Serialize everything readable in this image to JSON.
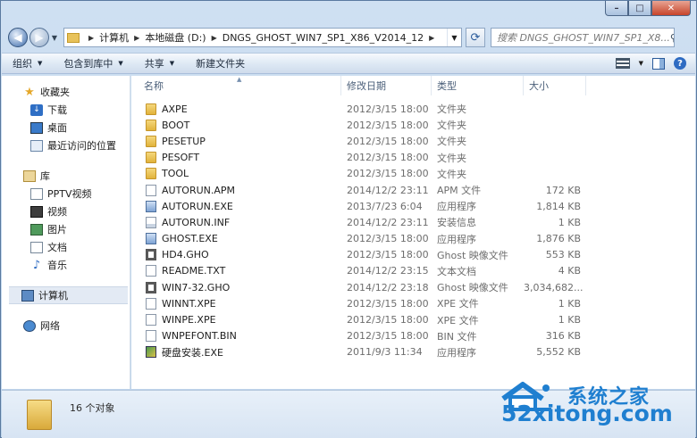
{
  "window": {
    "buttons": {
      "minimize": "–",
      "maximize": "□",
      "close": "✕"
    }
  },
  "addressbar": {
    "crumbs": [
      "计算机",
      "本地磁盘 (D:)",
      "DNGS_GHOST_WIN7_SP1_X86_V2014_12"
    ],
    "search_placeholder": "搜索 DNGS_GHOST_WIN7_SP1_X8..."
  },
  "toolbar": {
    "organize": "组织",
    "include_in_library": "包含到库中",
    "share": "共享",
    "new_folder": "新建文件夹"
  },
  "navpane": {
    "favorites": {
      "label": "收藏夹",
      "items": [
        "下载",
        "桌面",
        "最近访问的位置"
      ]
    },
    "libraries": {
      "label": "库",
      "items": [
        "PPTV视频",
        "视频",
        "图片",
        "文档",
        "音乐"
      ]
    },
    "computer": "计算机",
    "network": "网络"
  },
  "columns": {
    "name": "名称",
    "date": "修改日期",
    "type": "类型",
    "size": "大小"
  },
  "files": [
    {
      "name": "AXPE",
      "date": "2012/3/15 18:00",
      "type": "文件夹",
      "size": "",
      "icon": "folder"
    },
    {
      "name": "BOOT",
      "date": "2012/3/15 18:00",
      "type": "文件夹",
      "size": "",
      "icon": "folder"
    },
    {
      "name": "PESETUP",
      "date": "2012/3/15 18:00",
      "type": "文件夹",
      "size": "",
      "icon": "folder"
    },
    {
      "name": "PESOFT",
      "date": "2012/3/15 18:00",
      "type": "文件夹",
      "size": "",
      "icon": "folder"
    },
    {
      "name": "TOOL",
      "date": "2012/3/15 18:00",
      "type": "文件夹",
      "size": "",
      "icon": "folder"
    },
    {
      "name": "AUTORUN.APM",
      "date": "2014/12/2 23:11",
      "type": "APM 文件",
      "size": "172 KB",
      "icon": "file"
    },
    {
      "name": "AUTORUN.EXE",
      "date": "2013/7/23 6:04",
      "type": "应用程序",
      "size": "1,814 KB",
      "icon": "exe"
    },
    {
      "name": "AUTORUN.INF",
      "date": "2014/12/2 23:11",
      "type": "安装信息",
      "size": "1 KB",
      "icon": "inf"
    },
    {
      "name": "GHOST.EXE",
      "date": "2012/3/15 18:00",
      "type": "应用程序",
      "size": "1,876 KB",
      "icon": "exe"
    },
    {
      "name": "HD4.GHO",
      "date": "2012/3/15 18:00",
      "type": "Ghost 映像文件",
      "size": "553 KB",
      "icon": "ghost"
    },
    {
      "name": "README.TXT",
      "date": "2014/12/2 23:15",
      "type": "文本文档",
      "size": "4 KB",
      "icon": "file"
    },
    {
      "name": "WIN7-32.GHO",
      "date": "2014/12/2 23:18",
      "type": "Ghost 映像文件",
      "size": "3,034,682...",
      "icon": "ghost"
    },
    {
      "name": "WINNT.XPE",
      "date": "2012/3/15 18:00",
      "type": "XPE 文件",
      "size": "1 KB",
      "icon": "file"
    },
    {
      "name": "WINPE.XPE",
      "date": "2012/3/15 18:00",
      "type": "XPE 文件",
      "size": "1 KB",
      "icon": "file"
    },
    {
      "name": "WNPEFONT.BIN",
      "date": "2012/3/15 18:00",
      "type": "BIN 文件",
      "size": "316 KB",
      "icon": "file"
    },
    {
      "name": "硬盘安装.EXE",
      "date": "2011/9/3 11:34",
      "type": "应用程序",
      "size": "5,552 KB",
      "icon": "setup"
    }
  ],
  "status": {
    "count": "16 个对象"
  },
  "watermark": {
    "title": "系统之家",
    "url": "52xitong.com"
  }
}
